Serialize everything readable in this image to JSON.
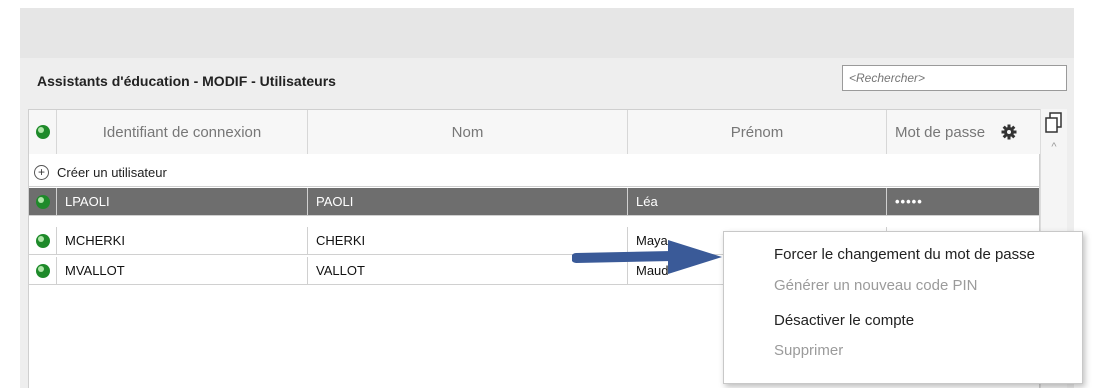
{
  "panel": {
    "title": "Assistants d'éducation - MODIF - Utilisateurs"
  },
  "search": {
    "placeholder": "<Rechercher>"
  },
  "table": {
    "headers": {
      "login": "Identifiant de connexion",
      "nom": "Nom",
      "prenom": "Prénom",
      "password": "Mot de passe"
    },
    "create_label": "Créer un utilisateur",
    "rows": [
      {
        "login": "LPAOLI",
        "nom": "PAOLI",
        "prenom": "Léa",
        "password": "•••••",
        "selected": true
      },
      {
        "login": "MCHERKI",
        "nom": "CHERKI",
        "prenom": "Maya",
        "password": "",
        "selected": false
      },
      {
        "login": "MVALLOT",
        "nom": "VALLOT",
        "prenom": "Maud",
        "password": "",
        "selected": false
      }
    ]
  },
  "context_menu": {
    "items": [
      {
        "label": "Forcer le changement du mot de passe",
        "enabled": true
      },
      {
        "label": "Générer un nouveau code PIN",
        "enabled": false
      },
      {
        "label": "Désactiver le compte",
        "enabled": true
      },
      {
        "label": "Supprimer",
        "enabled": false
      }
    ]
  },
  "colors": {
    "selected_row": "#6e6e6e",
    "status_dot": "#1e8a2a",
    "arrow": "#3a5a98"
  }
}
